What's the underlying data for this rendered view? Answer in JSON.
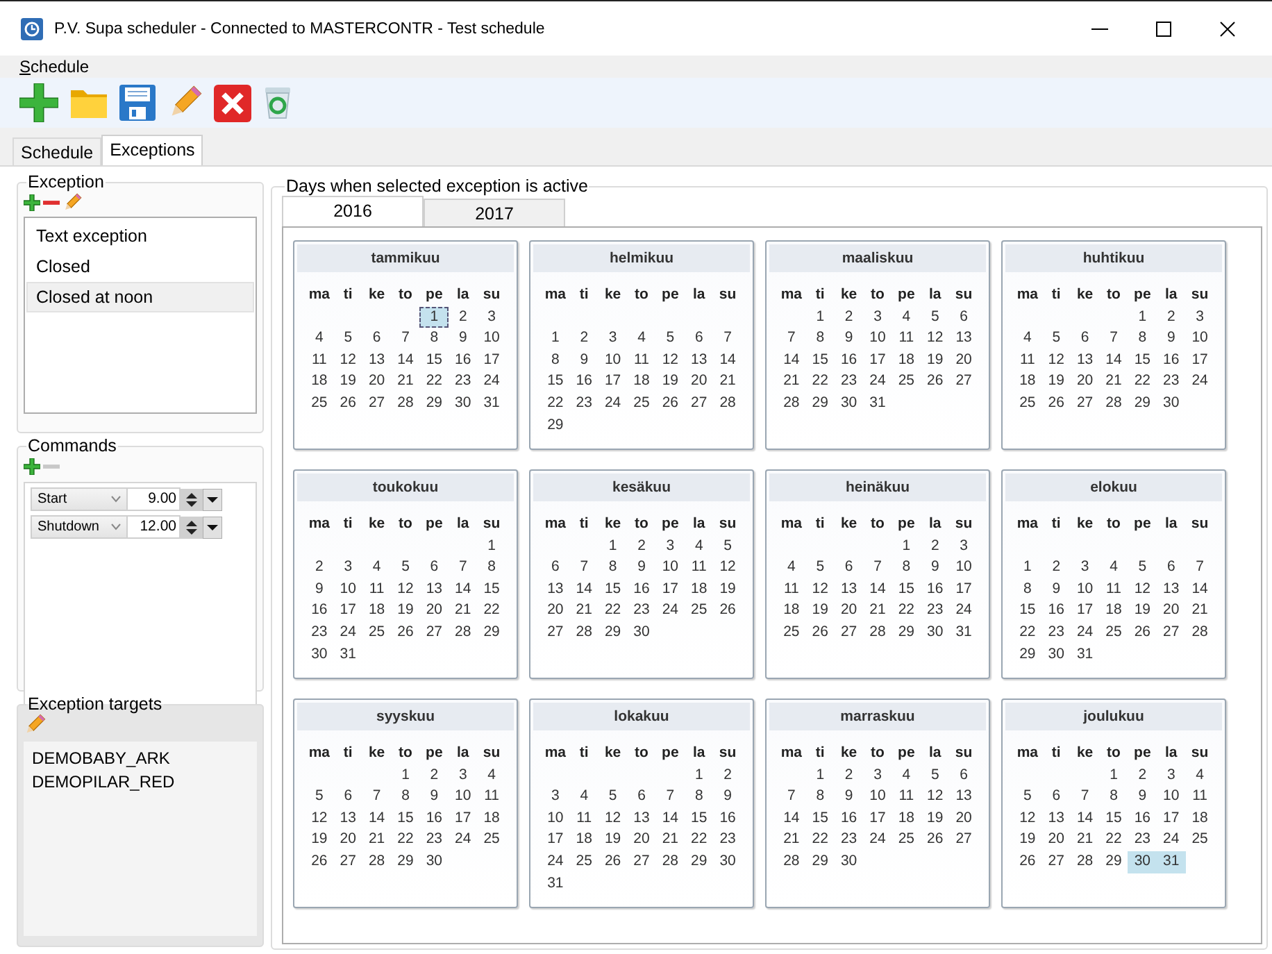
{
  "window": {
    "title": "P.V. Supa scheduler - Connected to MASTERCONTR - Test schedule"
  },
  "menu": [
    {
      "label": "Schedule"
    }
  ],
  "tabs": [
    {
      "label": "Schedule",
      "selected": false
    },
    {
      "label": "Exceptions",
      "selected": true
    }
  ],
  "exception": {
    "title": "Exception",
    "remove_disabled": false,
    "items": [
      {
        "label": "Text exception",
        "selected": false
      },
      {
        "label": "Closed",
        "selected": false
      },
      {
        "label": "Closed at noon",
        "selected": true
      }
    ]
  },
  "commands": {
    "title": "Commands",
    "remove_disabled": true,
    "rows": [
      {
        "command": "Start",
        "time": "9.00"
      },
      {
        "command": "Shutdown",
        "time": "12.00"
      }
    ]
  },
  "targets": {
    "title": "Exception targets",
    "items": [
      "DEMOBABY_ARK",
      "DEMOPILAR_RED"
    ]
  },
  "days": {
    "title": "Days when selected exception is active",
    "years": [
      {
        "label": "2016",
        "selected": true
      },
      {
        "label": "2017",
        "selected": false
      }
    ],
    "months": [
      {
        "name": "tammikuu",
        "weekdays": [
          "ma",
          "ti",
          "ke",
          "to",
          "pe",
          "la",
          "su"
        ],
        "blank_first_row": false,
        "weeks": [
          [
            {
              "day": "1",
              "selected": true,
              "focused": true
            },
            {
              "day": "2",
              "selected": false
            },
            {
              "day": "3",
              "selected": false
            }
          ],
          [
            {
              "day": "4",
              "selected": false
            },
            {
              "day": "5",
              "selected": false
            },
            {
              "day": "6",
              "selected": false
            },
            {
              "day": "7",
              "selected": false
            },
            {
              "day": "8",
              "selected": false
            },
            {
              "day": "9",
              "selected": false
            },
            {
              "day": "10",
              "selected": false
            }
          ],
          [
            {
              "day": "11",
              "selected": false
            },
            {
              "day": "12",
              "selected": false
            },
            {
              "day": "13",
              "selected": false
            },
            {
              "day": "14",
              "selected": false
            },
            {
              "day": "15",
              "selected": false
            },
            {
              "day": "16",
              "selected": false
            },
            {
              "day": "17",
              "selected": false
            }
          ],
          [
            {
              "day": "18",
              "selected": false
            },
            {
              "day": "19",
              "selected": false
            },
            {
              "day": "20",
              "selected": false
            },
            {
              "day": "21",
              "selected": false
            },
            {
              "day": "22",
              "selected": false
            },
            {
              "day": "23",
              "selected": false
            },
            {
              "day": "24",
              "selected": false
            }
          ],
          [
            {
              "day": "25",
              "selected": false
            },
            {
              "day": "26",
              "selected": false
            },
            {
              "day": "27",
              "selected": false
            },
            {
              "day": "28",
              "selected": false
            },
            {
              "day": "29",
              "selected": false
            },
            {
              "day": "30",
              "selected": false
            },
            {
              "day": "31",
              "selected": false
            }
          ]
        ]
      },
      {
        "name": "helmikuu",
        "weekdays": [
          "ma",
          "ti",
          "ke",
          "to",
          "pe",
          "la",
          "su"
        ],
        "blank_first_row": true,
        "weeks": [
          [
            {
              "day": "1",
              "selected": false
            },
            {
              "day": "2",
              "selected": false
            },
            {
              "day": "3",
              "selected": false
            },
            {
              "day": "4",
              "selected": false
            },
            {
              "day": "5",
              "selected": false
            },
            {
              "day": "6",
              "selected": false
            },
            {
              "day": "7",
              "selected": false
            }
          ],
          [
            {
              "day": "8",
              "selected": false
            },
            {
              "day": "9",
              "selected": false
            },
            {
              "day": "10",
              "selected": false
            },
            {
              "day": "11",
              "selected": false
            },
            {
              "day": "12",
              "selected": false
            },
            {
              "day": "13",
              "selected": false
            },
            {
              "day": "14",
              "selected": false
            }
          ],
          [
            {
              "day": "15",
              "selected": false
            },
            {
              "day": "16",
              "selected": false
            },
            {
              "day": "17",
              "selected": false
            },
            {
              "day": "18",
              "selected": false
            },
            {
              "day": "19",
              "selected": false
            },
            {
              "day": "20",
              "selected": false
            },
            {
              "day": "21",
              "selected": false
            }
          ],
          [
            {
              "day": "22",
              "selected": false
            },
            {
              "day": "23",
              "selected": false
            },
            {
              "day": "24",
              "selected": false
            },
            {
              "day": "25",
              "selected": false
            },
            {
              "day": "26",
              "selected": false
            },
            {
              "day": "27",
              "selected": false
            },
            {
              "day": "28",
              "selected": false
            }
          ],
          [
            {
              "day": "29",
              "selected": false
            }
          ]
        ]
      },
      {
        "name": "maaliskuu",
        "weekdays": [
          "ma",
          "ti",
          "ke",
          "to",
          "pe",
          "la",
          "su"
        ],
        "blank_first_row": false,
        "weeks": [
          [
            {
              "day": "1",
              "selected": false
            },
            {
              "day": "2",
              "selected": false
            },
            {
              "day": "3",
              "selected": false
            },
            {
              "day": "4",
              "selected": false
            },
            {
              "day": "5",
              "selected": false
            },
            {
              "day": "6",
              "selected": false
            }
          ],
          [
            {
              "day": "7",
              "selected": false
            },
            {
              "day": "8",
              "selected": false
            },
            {
              "day": "9",
              "selected": false
            },
            {
              "day": "10",
              "selected": false
            },
            {
              "day": "11",
              "selected": false
            },
            {
              "day": "12",
              "selected": false
            },
            {
              "day": "13",
              "selected": false
            }
          ],
          [
            {
              "day": "14",
              "selected": false
            },
            {
              "day": "15",
              "selected": false
            },
            {
              "day": "16",
              "selected": false
            },
            {
              "day": "17",
              "selected": false
            },
            {
              "day": "18",
              "selected": false
            },
            {
              "day": "19",
              "selected": false
            },
            {
              "day": "20",
              "selected": false
            }
          ],
          [
            {
              "day": "21",
              "selected": false
            },
            {
              "day": "22",
              "selected": false
            },
            {
              "day": "23",
              "selected": false
            },
            {
              "day": "24",
              "selected": false
            },
            {
              "day": "25",
              "selected": false
            },
            {
              "day": "26",
              "selected": false
            },
            {
              "day": "27",
              "selected": false
            }
          ],
          [
            {
              "day": "28",
              "selected": false
            },
            {
              "day": "29",
              "selected": false
            },
            {
              "day": "30",
              "selected": false
            },
            {
              "day": "31",
              "selected": false
            }
          ]
        ]
      },
      {
        "name": "huhtikuu",
        "weekdays": [
          "ma",
          "ti",
          "ke",
          "to",
          "pe",
          "la",
          "su"
        ],
        "blank_first_row": false,
        "weeks": [
          [
            {
              "day": "1",
              "selected": false
            },
            {
              "day": "2",
              "selected": false
            },
            {
              "day": "3",
              "selected": false
            }
          ],
          [
            {
              "day": "4",
              "selected": false
            },
            {
              "day": "5",
              "selected": false
            },
            {
              "day": "6",
              "selected": false
            },
            {
              "day": "7",
              "selected": false
            },
            {
              "day": "8",
              "selected": false
            },
            {
              "day": "9",
              "selected": false
            },
            {
              "day": "10",
              "selected": false
            }
          ],
          [
            {
              "day": "11",
              "selected": false
            },
            {
              "day": "12",
              "selected": false
            },
            {
              "day": "13",
              "selected": false
            },
            {
              "day": "14",
              "selected": false
            },
            {
              "day": "15",
              "selected": false
            },
            {
              "day": "16",
              "selected": false
            },
            {
              "day": "17",
              "selected": false
            }
          ],
          [
            {
              "day": "18",
              "selected": false
            },
            {
              "day": "19",
              "selected": false
            },
            {
              "day": "20",
              "selected": false
            },
            {
              "day": "21",
              "selected": false
            },
            {
              "day": "22",
              "selected": false
            },
            {
              "day": "23",
              "selected": false
            },
            {
              "day": "24",
              "selected": false
            }
          ],
          [
            {
              "day": "25",
              "selected": false
            },
            {
              "day": "26",
              "selected": false
            },
            {
              "day": "27",
              "selected": false
            },
            {
              "day": "28",
              "selected": false
            },
            {
              "day": "29",
              "selected": false
            },
            {
              "day": "30",
              "selected": false
            }
          ]
        ]
      },
      {
        "name": "toukokuu",
        "weekdays": [
          "ma",
          "ti",
          "ke",
          "to",
          "pe",
          "la",
          "su"
        ],
        "blank_first_row": false,
        "weeks": [
          [
            {
              "day": "1",
              "selected": false
            }
          ],
          [
            {
              "day": "2",
              "selected": false
            },
            {
              "day": "3",
              "selected": false
            },
            {
              "day": "4",
              "selected": false
            },
            {
              "day": "5",
              "selected": false
            },
            {
              "day": "6",
              "selected": false
            },
            {
              "day": "7",
              "selected": false
            },
            {
              "day": "8",
              "selected": false
            }
          ],
          [
            {
              "day": "9",
              "selected": false
            },
            {
              "day": "10",
              "selected": false
            },
            {
              "day": "11",
              "selected": false
            },
            {
              "day": "12",
              "selected": false
            },
            {
              "day": "13",
              "selected": false
            },
            {
              "day": "14",
              "selected": false
            },
            {
              "day": "15",
              "selected": false
            }
          ],
          [
            {
              "day": "16",
              "selected": false
            },
            {
              "day": "17",
              "selected": false
            },
            {
              "day": "18",
              "selected": false
            },
            {
              "day": "19",
              "selected": false
            },
            {
              "day": "20",
              "selected": false
            },
            {
              "day": "21",
              "selected": false
            },
            {
              "day": "22",
              "selected": false
            }
          ],
          [
            {
              "day": "23",
              "selected": false
            },
            {
              "day": "24",
              "selected": false
            },
            {
              "day": "25",
              "selected": false
            },
            {
              "day": "26",
              "selected": false
            },
            {
              "day": "27",
              "selected": false
            },
            {
              "day": "28",
              "selected": false
            },
            {
              "day": "29",
              "selected": false
            }
          ],
          [
            {
              "day": "30",
              "selected": false
            },
            {
              "day": "31",
              "selected": false
            }
          ]
        ]
      },
      {
        "name": "kesäkuu",
        "weekdays": [
          "ma",
          "ti",
          "ke",
          "to",
          "pe",
          "la",
          "su"
        ],
        "blank_first_row": false,
        "weeks": [
          [
            {
              "day": "1",
              "selected": false
            },
            {
              "day": "2",
              "selected": false
            },
            {
              "day": "3",
              "selected": false
            },
            {
              "day": "4",
              "selected": false
            },
            {
              "day": "5",
              "selected": false
            }
          ],
          [
            {
              "day": "6",
              "selected": false
            },
            {
              "day": "7",
              "selected": false
            },
            {
              "day": "8",
              "selected": false
            },
            {
              "day": "9",
              "selected": false
            },
            {
              "day": "10",
              "selected": false
            },
            {
              "day": "11",
              "selected": false
            },
            {
              "day": "12",
              "selected": false
            }
          ],
          [
            {
              "day": "13",
              "selected": false
            },
            {
              "day": "14",
              "selected": false
            },
            {
              "day": "15",
              "selected": false
            },
            {
              "day": "16",
              "selected": false
            },
            {
              "day": "17",
              "selected": false
            },
            {
              "day": "18",
              "selected": false
            },
            {
              "day": "19",
              "selected": false
            }
          ],
          [
            {
              "day": "20",
              "selected": false
            },
            {
              "day": "21",
              "selected": false
            },
            {
              "day": "22",
              "selected": false
            },
            {
              "day": "23",
              "selected": false
            },
            {
              "day": "24",
              "selected": false
            },
            {
              "day": "25",
              "selected": false
            },
            {
              "day": "26",
              "selected": false
            }
          ],
          [
            {
              "day": "27",
              "selected": false
            },
            {
              "day": "28",
              "selected": false
            },
            {
              "day": "29",
              "selected": false
            },
            {
              "day": "30",
              "selected": false
            }
          ]
        ]
      },
      {
        "name": "heinäkuu",
        "weekdays": [
          "ma",
          "ti",
          "ke",
          "to",
          "pe",
          "la",
          "su"
        ],
        "blank_first_row": false,
        "weeks": [
          [
            {
              "day": "1",
              "selected": false
            },
            {
              "day": "2",
              "selected": false
            },
            {
              "day": "3",
              "selected": false
            }
          ],
          [
            {
              "day": "4",
              "selected": false
            },
            {
              "day": "5",
              "selected": false
            },
            {
              "day": "6",
              "selected": false
            },
            {
              "day": "7",
              "selected": false
            },
            {
              "day": "8",
              "selected": false
            },
            {
              "day": "9",
              "selected": false
            },
            {
              "day": "10",
              "selected": false
            }
          ],
          [
            {
              "day": "11",
              "selected": false
            },
            {
              "day": "12",
              "selected": false
            },
            {
              "day": "13",
              "selected": false
            },
            {
              "day": "14",
              "selected": false
            },
            {
              "day": "15",
              "selected": false
            },
            {
              "day": "16",
              "selected": false
            },
            {
              "day": "17",
              "selected": false
            }
          ],
          [
            {
              "day": "18",
              "selected": false
            },
            {
              "day": "19",
              "selected": false
            },
            {
              "day": "20",
              "selected": false
            },
            {
              "day": "21",
              "selected": false
            },
            {
              "day": "22",
              "selected": false
            },
            {
              "day": "23",
              "selected": false
            },
            {
              "day": "24",
              "selected": false
            }
          ],
          [
            {
              "day": "25",
              "selected": false
            },
            {
              "day": "26",
              "selected": false
            },
            {
              "day": "27",
              "selected": false
            },
            {
              "day": "28",
              "selected": false
            },
            {
              "day": "29",
              "selected": false
            },
            {
              "day": "30",
              "selected": false
            },
            {
              "day": "31",
              "selected": false
            }
          ]
        ]
      },
      {
        "name": "elokuu",
        "weekdays": [
          "ma",
          "ti",
          "ke",
          "to",
          "pe",
          "la",
          "su"
        ],
        "blank_first_row": true,
        "weeks": [
          [
            {
              "day": "1",
              "selected": false
            },
            {
              "day": "2",
              "selected": false
            },
            {
              "day": "3",
              "selected": false
            },
            {
              "day": "4",
              "selected": false
            },
            {
              "day": "5",
              "selected": false
            },
            {
              "day": "6",
              "selected": false
            },
            {
              "day": "7",
              "selected": false
            }
          ],
          [
            {
              "day": "8",
              "selected": false
            },
            {
              "day": "9",
              "selected": false
            },
            {
              "day": "10",
              "selected": false
            },
            {
              "day": "11",
              "selected": false
            },
            {
              "day": "12",
              "selected": false
            },
            {
              "day": "13",
              "selected": false
            },
            {
              "day": "14",
              "selected": false
            }
          ],
          [
            {
              "day": "15",
              "selected": false
            },
            {
              "day": "16",
              "selected": false
            },
            {
              "day": "17",
              "selected": false
            },
            {
              "day": "18",
              "selected": false
            },
            {
              "day": "19",
              "selected": false
            },
            {
              "day": "20",
              "selected": false
            },
            {
              "day": "21",
              "selected": false
            }
          ],
          [
            {
              "day": "22",
              "selected": false
            },
            {
              "day": "23",
              "selected": false
            },
            {
              "day": "24",
              "selected": false
            },
            {
              "day": "25",
              "selected": false
            },
            {
              "day": "26",
              "selected": false
            },
            {
              "day": "27",
              "selected": false
            },
            {
              "day": "28",
              "selected": false
            }
          ],
          [
            {
              "day": "29",
              "selected": false
            },
            {
              "day": "30",
              "selected": false
            },
            {
              "day": "31",
              "selected": false
            }
          ]
        ]
      },
      {
        "name": "syyskuu",
        "weekdays": [
          "ma",
          "ti",
          "ke",
          "to",
          "pe",
          "la",
          "su"
        ],
        "blank_first_row": false,
        "weeks": [
          [
            {
              "day": "1",
              "selected": false
            },
            {
              "day": "2",
              "selected": false
            },
            {
              "day": "3",
              "selected": false
            },
            {
              "day": "4",
              "selected": false
            }
          ],
          [
            {
              "day": "5",
              "selected": false
            },
            {
              "day": "6",
              "selected": false
            },
            {
              "day": "7",
              "selected": false
            },
            {
              "day": "8",
              "selected": false
            },
            {
              "day": "9",
              "selected": false
            },
            {
              "day": "10",
              "selected": false
            },
            {
              "day": "11",
              "selected": false
            }
          ],
          [
            {
              "day": "12",
              "selected": false
            },
            {
              "day": "13",
              "selected": false
            },
            {
              "day": "14",
              "selected": false
            },
            {
              "day": "15",
              "selected": false
            },
            {
              "day": "16",
              "selected": false
            },
            {
              "day": "17",
              "selected": false
            },
            {
              "day": "18",
              "selected": false
            }
          ],
          [
            {
              "day": "19",
              "selected": false
            },
            {
              "day": "20",
              "selected": false
            },
            {
              "day": "21",
              "selected": false
            },
            {
              "day": "22",
              "selected": false
            },
            {
              "day": "23",
              "selected": false
            },
            {
              "day": "24",
              "selected": false
            },
            {
              "day": "25",
              "selected": false
            }
          ],
          [
            {
              "day": "26",
              "selected": false
            },
            {
              "day": "27",
              "selected": false
            },
            {
              "day": "28",
              "selected": false
            },
            {
              "day": "29",
              "selected": false
            },
            {
              "day": "30",
              "selected": false
            }
          ]
        ]
      },
      {
        "name": "lokakuu",
        "weekdays": [
          "ma",
          "ti",
          "ke",
          "to",
          "pe",
          "la",
          "su"
        ],
        "blank_first_row": false,
        "weeks": [
          [
            {
              "day": "1",
              "selected": false
            },
            {
              "day": "2",
              "selected": false
            }
          ],
          [
            {
              "day": "3",
              "selected": false
            },
            {
              "day": "4",
              "selected": false
            },
            {
              "day": "5",
              "selected": false
            },
            {
              "day": "6",
              "selected": false
            },
            {
              "day": "7",
              "selected": false
            },
            {
              "day": "8",
              "selected": false
            },
            {
              "day": "9",
              "selected": false
            }
          ],
          [
            {
              "day": "10",
              "selected": false
            },
            {
              "day": "11",
              "selected": false
            },
            {
              "day": "12",
              "selected": false
            },
            {
              "day": "13",
              "selected": false
            },
            {
              "day": "14",
              "selected": false
            },
            {
              "day": "15",
              "selected": false
            },
            {
              "day": "16",
              "selected": false
            }
          ],
          [
            {
              "day": "17",
              "selected": false
            },
            {
              "day": "18",
              "selected": false
            },
            {
              "day": "19",
              "selected": false
            },
            {
              "day": "20",
              "selected": false
            },
            {
              "day": "21",
              "selected": false
            },
            {
              "day": "22",
              "selected": false
            },
            {
              "day": "23",
              "selected": false
            }
          ],
          [
            {
              "day": "24",
              "selected": false
            },
            {
              "day": "25",
              "selected": false
            },
            {
              "day": "26",
              "selected": false
            },
            {
              "day": "27",
              "selected": false
            },
            {
              "day": "28",
              "selected": false
            },
            {
              "day": "29",
              "selected": false
            },
            {
              "day": "30",
              "selected": false
            }
          ],
          [
            {
              "day": "31",
              "selected": false
            }
          ]
        ]
      },
      {
        "name": "marraskuu",
        "weekdays": [
          "ma",
          "ti",
          "ke",
          "to",
          "pe",
          "la",
          "su"
        ],
        "blank_first_row": false,
        "weeks": [
          [
            {
              "day": "1",
              "selected": false
            },
            {
              "day": "2",
              "selected": false
            },
            {
              "day": "3",
              "selected": false
            },
            {
              "day": "4",
              "selected": false
            },
            {
              "day": "5",
              "selected": false
            },
            {
              "day": "6",
              "selected": false
            }
          ],
          [
            {
              "day": "7",
              "selected": false
            },
            {
              "day": "8",
              "selected": false
            },
            {
              "day": "9",
              "selected": false
            },
            {
              "day": "10",
              "selected": false
            },
            {
              "day": "11",
              "selected": false
            },
            {
              "day": "12",
              "selected": false
            },
            {
              "day": "13",
              "selected": false
            }
          ],
          [
            {
              "day": "14",
              "selected": false
            },
            {
              "day": "15",
              "selected": false
            },
            {
              "day": "16",
              "selected": false
            },
            {
              "day": "17",
              "selected": false
            },
            {
              "day": "18",
              "selected": false
            },
            {
              "day": "19",
              "selected": false
            },
            {
              "day": "20",
              "selected": false
            }
          ],
          [
            {
              "day": "21",
              "selected": false
            },
            {
              "day": "22",
              "selected": false
            },
            {
              "day": "23",
              "selected": false
            },
            {
              "day": "24",
              "selected": false
            },
            {
              "day": "25",
              "selected": false
            },
            {
              "day": "26",
              "selected": false
            },
            {
              "day": "27",
              "selected": false
            }
          ],
          [
            {
              "day": "28",
              "selected": false
            },
            {
              "day": "29",
              "selected": false
            },
            {
              "day": "30",
              "selected": false
            }
          ]
        ]
      },
      {
        "name": "joulukuu",
        "weekdays": [
          "ma",
          "ti",
          "ke",
          "to",
          "pe",
          "la",
          "su"
        ],
        "blank_first_row": false,
        "weeks": [
          [
            {
              "day": "1",
              "selected": false
            },
            {
              "day": "2",
              "selected": false
            },
            {
              "day": "3",
              "selected": false
            },
            {
              "day": "4",
              "selected": false
            }
          ],
          [
            {
              "day": "5",
              "selected": false
            },
            {
              "day": "6",
              "selected": false
            },
            {
              "day": "7",
              "selected": false
            },
            {
              "day": "8",
              "selected": false
            },
            {
              "day": "9",
              "selected": false
            },
            {
              "day": "10",
              "selected": false
            },
            {
              "day": "11",
              "selected": false
            }
          ],
          [
            {
              "day": "12",
              "selected": false
            },
            {
              "day": "13",
              "selected": false
            },
            {
              "day": "14",
              "selected": false
            },
            {
              "day": "15",
              "selected": false
            },
            {
              "day": "16",
              "selected": false
            },
            {
              "day": "17",
              "selected": false
            },
            {
              "day": "18",
              "selected": false
            }
          ],
          [
            {
              "day": "19",
              "selected": false
            },
            {
              "day": "20",
              "selected": false
            },
            {
              "day": "21",
              "selected": false
            },
            {
              "day": "22",
              "selected": false
            },
            {
              "day": "23",
              "selected": false
            },
            {
              "day": "24",
              "selected": false
            },
            {
              "day": "25",
              "selected": false
            }
          ],
          [
            {
              "day": "26",
              "selected": false
            },
            {
              "day": "27",
              "selected": false
            },
            {
              "day": "28",
              "selected": false
            },
            {
              "day": "29",
              "selected": false
            },
            {
              "day": "30",
              "selected": true
            },
            {
              "day": "31",
              "selected": true
            }
          ]
        ]
      }
    ]
  }
}
